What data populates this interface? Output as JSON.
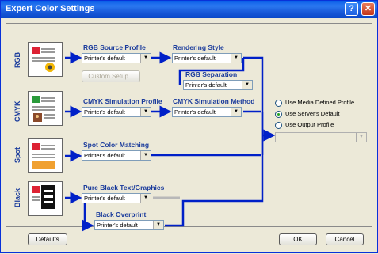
{
  "window": {
    "title": "Expert Color Settings",
    "help_icon": "?",
    "close_icon": "✕"
  },
  "rows": {
    "rgb": {
      "label": "RGB",
      "source_profile": {
        "heading": "RGB Source Profile",
        "value": "Printer's default"
      },
      "custom_setup": "Custom Setup...",
      "rendering_style": {
        "heading": "Rendering Style",
        "value": "Printer's default"
      },
      "rgb_separation": {
        "heading": "RGB Separation",
        "value": "Printer's default"
      }
    },
    "cmyk": {
      "label": "CMYK",
      "simulation_profile": {
        "heading": "CMYK Simulation Profile",
        "value": "Printer's default"
      },
      "simulation_method": {
        "heading": "CMYK Simulation Method",
        "value": "Printer's default"
      }
    },
    "spot": {
      "label": "Spot",
      "spot_color_matching": {
        "heading": "Spot Color Matching",
        "value": "Printer's default"
      }
    },
    "black": {
      "label": "Black",
      "pure_black": {
        "heading": "Pure Black Text/Graphics",
        "value": "Printer's default"
      },
      "black_overprint": {
        "heading": "Black Overprint",
        "value": "Printer's default"
      }
    }
  },
  "output": {
    "options": [
      {
        "label": "Use Media Defined Profile",
        "selected": false
      },
      {
        "label": "Use Server's Default",
        "selected": true
      },
      {
        "label": "Use Output Profile",
        "selected": false
      }
    ],
    "profile_value": ""
  },
  "footer": {
    "defaults": "Defaults",
    "ok": "OK",
    "cancel": "Cancel"
  },
  "colors": {
    "titlebar": "#0a5ee8",
    "heading": "#1a3b9c",
    "flow_line": "#0020c8"
  }
}
